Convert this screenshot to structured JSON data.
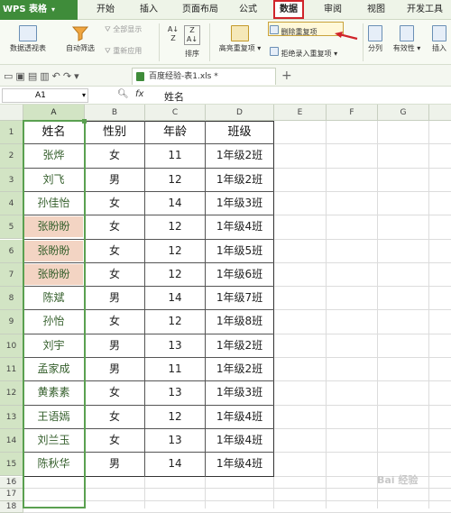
{
  "app": {
    "logo": "WPS 表格"
  },
  "menus": [
    "开始",
    "插入",
    "页面布局",
    "公式",
    "数据",
    "审阅",
    "视图",
    "开发工具"
  ],
  "ribbon": {
    "pivot": "数据透视表",
    "autofilter": "自动筛选",
    "show_all": "全部显示",
    "reapply": "重新应用",
    "sort": "排序",
    "highlight_dup": "高亮重复项",
    "remove_dup": "删除重复项",
    "reject_dup": "拒绝录入重复项",
    "split": "分列",
    "validity": "有效性",
    "insert": "插入"
  },
  "tabs": {
    "file": "百度经验-表1.xls *"
  },
  "formula": {
    "cell_ref": "A1",
    "fx": "fx",
    "value": "姓名"
  },
  "columns": [
    "A",
    "B",
    "C",
    "D",
    "E",
    "F",
    "G"
  ],
  "rows": [
    "1",
    "2",
    "3",
    "4",
    "5",
    "6",
    "7",
    "8",
    "9",
    "10",
    "11",
    "12",
    "13",
    "14",
    "15",
    "16",
    "17",
    "18"
  ],
  "headers": [
    "姓名",
    "性别",
    "年龄",
    "班级"
  ],
  "table": [
    [
      "张烨",
      "女",
      "11",
      "1年级2班"
    ],
    [
      "刘飞",
      "男",
      "12",
      "1年级2班"
    ],
    [
      "孙佳怡",
      "女",
      "14",
      "1年级3班"
    ],
    [
      "张盼盼",
      "女",
      "12",
      "1年级4班"
    ],
    [
      "张盼盼",
      "女",
      "12",
      "1年级5班"
    ],
    [
      "张盼盼",
      "女",
      "12",
      "1年级6班"
    ],
    [
      "陈斌",
      "男",
      "14",
      "1年级7班"
    ],
    [
      "孙怡",
      "女",
      "12",
      "1年级8班"
    ],
    [
      "刘宇",
      "男",
      "13",
      "1年级2班"
    ],
    [
      "孟家成",
      "男",
      "11",
      "1年级2班"
    ],
    [
      "黄素素",
      "女",
      "13",
      "1年级3班"
    ],
    [
      "王语嫣",
      "女",
      "12",
      "1年级4班"
    ],
    [
      "刘兰玉",
      "女",
      "13",
      "1年级4班"
    ],
    [
      "陈秋华",
      "男",
      "14",
      "1年级4班"
    ]
  ],
  "watermark": "Bai 经验",
  "colors": {
    "brand": "#3f8c3a",
    "duplicate": "#f3d4c3",
    "selection": "#5aa050",
    "highlight_tab": "#d0242a"
  }
}
